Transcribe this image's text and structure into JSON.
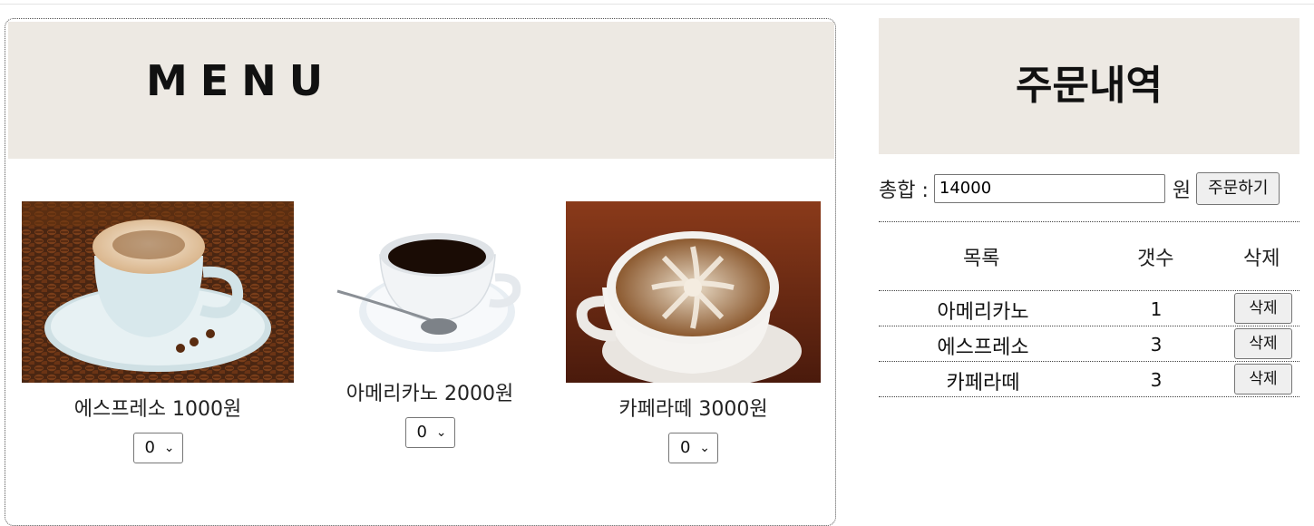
{
  "menu": {
    "title": "MENU",
    "items": [
      {
        "name": "에스프레소 1000원",
        "qty": "0",
        "image": "espresso-photo"
      },
      {
        "name": "아메리카노 2000원",
        "qty": "0",
        "image": "americano-photo"
      },
      {
        "name": "카페라떼 3000원",
        "qty": "0",
        "image": "cafe-latte-photo"
      }
    ]
  },
  "order": {
    "title": "주문내역",
    "total_label": "총합 :",
    "total_value": "14000",
    "currency": "원",
    "order_button": "주문하기",
    "headers": {
      "item": "목록",
      "count": "갯수",
      "delete": "삭제"
    },
    "rows": [
      {
        "item": "아메리카노",
        "count": "1",
        "delete": "삭제"
      },
      {
        "item": "에스프레소",
        "count": "3",
        "delete": "삭제"
      },
      {
        "item": "카페라떼",
        "count": "3",
        "delete": "삭제"
      }
    ]
  },
  "colors": {
    "header_bg": "#ede9e3",
    "button_bg": "#efefef"
  }
}
